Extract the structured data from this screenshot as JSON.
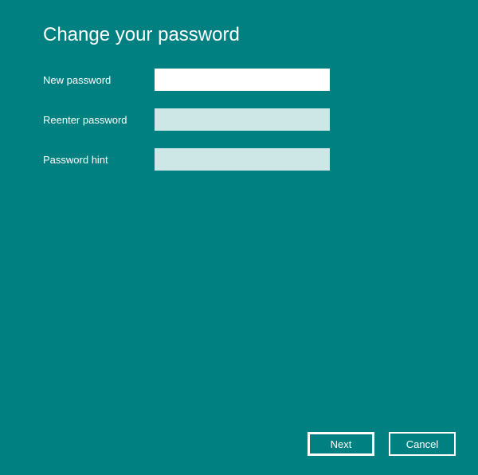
{
  "title": "Change your password",
  "fields": {
    "new_password": {
      "label": "New password",
      "value": ""
    },
    "reenter_password": {
      "label": "Reenter password",
      "value": ""
    },
    "password_hint": {
      "label": "Password hint",
      "value": ""
    }
  },
  "buttons": {
    "next": "Next",
    "cancel": "Cancel"
  },
  "colors": {
    "background": "#008080",
    "input_active": "#ffffff",
    "input_inactive": "#cde6e6",
    "text": "#ffffff"
  }
}
